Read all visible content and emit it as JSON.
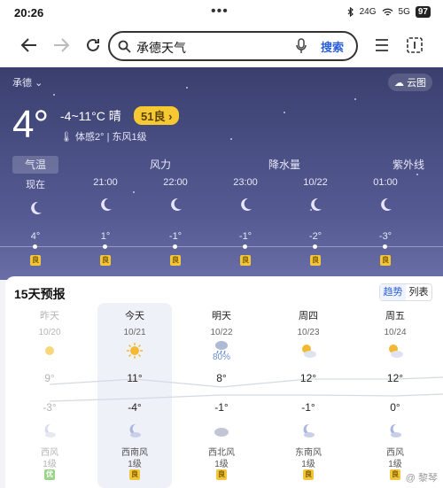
{
  "status": {
    "time": "20:26",
    "dots": "•••",
    "signal": "24G",
    "network": "5G",
    "battery": "97"
  },
  "browser": {
    "query": "承德天气",
    "search_label": "搜索"
  },
  "weather": {
    "city": "承德",
    "cloud_map": "云图",
    "temp": "4°",
    "range": "-4~11°C 晴",
    "aqi": "51良",
    "feels": "体感2°",
    "wind": "东风1级",
    "tabs": [
      "气温",
      "风力",
      "降水量",
      "紫外线"
    ],
    "hours": [
      {
        "time": "现在",
        "temp": "4°",
        "aqi": "良"
      },
      {
        "time": "21:00",
        "temp": "1°",
        "aqi": "良"
      },
      {
        "time": "22:00",
        "temp": "-1°",
        "aqi": "良"
      },
      {
        "time": "23:00",
        "temp": "-1°",
        "aqi": "良"
      },
      {
        "time": "10/22",
        "temp": "-2°",
        "aqi": "良"
      },
      {
        "time": "01:00",
        "temp": "-3°",
        "aqi": "良"
      }
    ]
  },
  "forecast": {
    "title": "15天预报",
    "toggle": [
      "趋势",
      "列表"
    ],
    "days": [
      {
        "name": "昨天",
        "date": "10/20",
        "hi": "9°",
        "lo": "-3°",
        "wind_dir": "西风",
        "wind_lvl": "1级",
        "aqi": "优",
        "precip": "",
        "day_icon": "sun-icon",
        "night_icon": "moon-cloud-icon"
      },
      {
        "name": "今天",
        "date": "10/21",
        "hi": "11°",
        "lo": "-4°",
        "wind_dir": "西南风",
        "wind_lvl": "1级",
        "aqi": "良",
        "precip": "",
        "day_icon": "sun-icon",
        "night_icon": "moon-cloud-icon"
      },
      {
        "name": "明天",
        "date": "10/22",
        "hi": "8°",
        "lo": "-1°",
        "wind_dir": "西北风",
        "wind_lvl": "1级",
        "aqi": "良",
        "precip": "80%",
        "day_icon": "rain-cloud-icon",
        "night_icon": "cloud-icon"
      },
      {
        "name": "周四",
        "date": "10/23",
        "hi": "12°",
        "lo": "-1°",
        "wind_dir": "东南风",
        "wind_lvl": "1级",
        "aqi": "良",
        "precip": "",
        "day_icon": "sun-cloud-icon",
        "night_icon": "moon-cloud-icon"
      },
      {
        "name": "周五",
        "date": "10/24",
        "hi": "12°",
        "lo": "0°",
        "wind_dir": "西风",
        "wind_lvl": "1级",
        "aqi": "良",
        "precip": "",
        "day_icon": "sun-cloud-icon",
        "night_icon": "moon-cloud-icon"
      }
    ],
    "watermark": "@ 黎琴"
  }
}
